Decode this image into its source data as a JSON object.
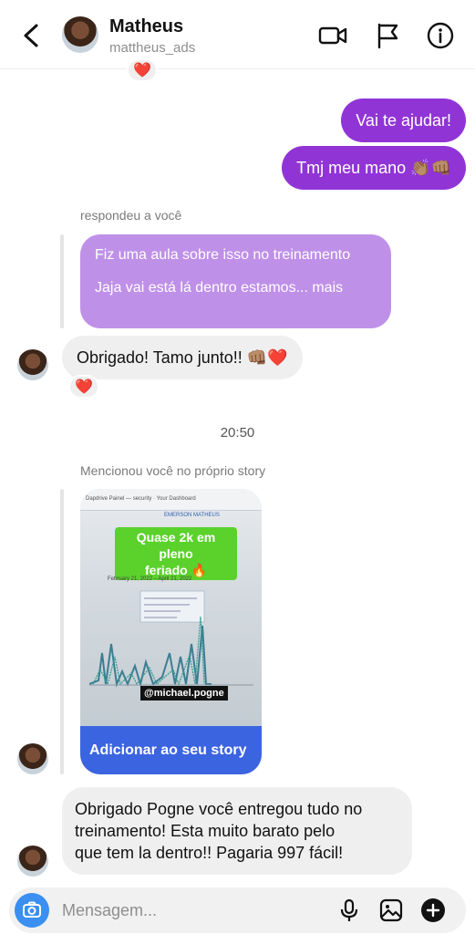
{
  "header": {
    "name": "Matheus",
    "username": "mattheus_ads",
    "back_icon": "chevron-left-icon",
    "actions": [
      "video-call-icon",
      "flag-icon",
      "info-icon"
    ]
  },
  "messages": {
    "top_reaction": "❤️",
    "sent_1": "Vai te ajudar!",
    "sent_2": "Tmj meu mano 👏🏽👊🏽",
    "reply_label": "respondeu a você",
    "reply_quote_line1": "Fiz uma aula sobre isso no treinamento",
    "reply_quote_line2": "Jaja vai está lá dentro estamos... mais",
    "recv_1": "Obrigado! Tamo junto!! 👊🏽❤️",
    "recv_1_reaction": "❤️",
    "timestamp": "20:50",
    "story_label": "Mencionou você no próprio story",
    "story": {
      "topbar": "Dapdrive Painel — security · Your Dashboard",
      "subtitle": "EMERSON MATHEUS",
      "sticker_line1": "Quase 2k em pleno",
      "sticker_line2": "feriado 🔥",
      "date_range": "February 21, 2022 – April 21, 2022",
      "mention": "@michael.pogne",
      "cta": "Adicionar ao seu story"
    },
    "recv_2_line1": "Obrigado Pogne você entregou tudo no",
    "recv_2_line2": "treinamento! Esta muito barato pelo",
    "recv_2_line3": "que tem la dentro!! Pagaria 997 fácil!"
  },
  "composer": {
    "placeholder": "Mensagem...",
    "icons": [
      "camera-icon",
      "microphone-icon",
      "gallery-icon",
      "plus-circle-icon"
    ]
  },
  "colors": {
    "sent_bubble": "#9134d6",
    "reply_bubble": "#bf90e8",
    "received_bubble": "#efefef",
    "cta": "#3b64e0",
    "sticker": "#5bd12c"
  }
}
